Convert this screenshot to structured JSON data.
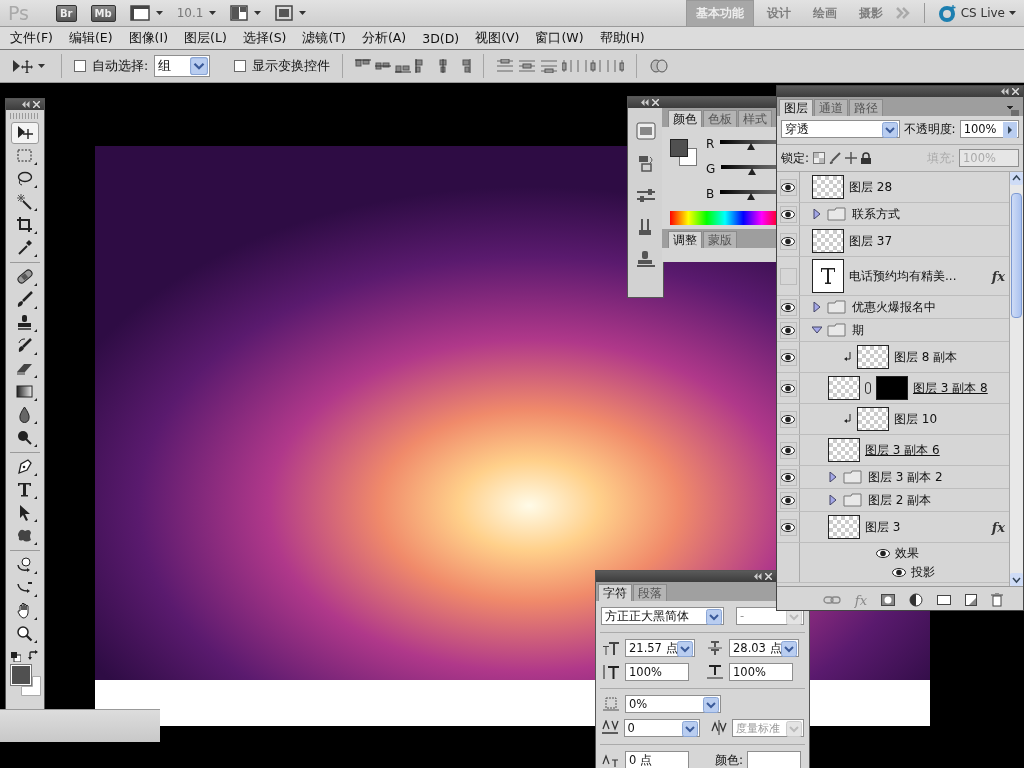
{
  "app_bar": {
    "logo": "Ps",
    "bridge_badge": "Br",
    "mini_bridge_badge": "Mb",
    "zoom": "10.1",
    "workspaces": [
      {
        "label": "基本功能",
        "selected": true
      },
      {
        "label": "设计",
        "selected": false
      },
      {
        "label": "绘画",
        "selected": false
      },
      {
        "label": "摄影",
        "selected": false
      }
    ],
    "cs_live": "CS Live"
  },
  "menu": [
    "文件(F)",
    "编辑(E)",
    "图像(I)",
    "图层(L)",
    "选择(S)",
    "滤镜(T)",
    "分析(A)",
    "3D(D)",
    "视图(V)",
    "窗口(W)",
    "帮助(H)"
  ],
  "options_bar": {
    "auto_select": {
      "label": "自动选择:",
      "checked": false
    },
    "auto_select_target": "组",
    "show_transform_controls": {
      "label": "显示变换控件",
      "checked": false
    }
  },
  "tools": [
    {
      "selected": true
    },
    {
      "selected": false
    },
    {
      "selected": false
    },
    {
      "selected": false
    },
    {
      "selected": false
    },
    {
      "selected": false
    },
    {
      "selected": false
    },
    {
      "selected": false
    },
    {
      "selected": false
    },
    {
      "selected": false
    },
    {
      "selected": false
    },
    {
      "selected": false
    },
    {
      "selected": false
    },
    {
      "selected": false
    },
    {
      "selected": false
    },
    {
      "selected": false
    },
    {
      "selected": false
    },
    {
      "selected": false
    },
    {
      "selected": false
    },
    {
      "selected": false
    },
    {
      "selected": false
    },
    {
      "selected": false
    }
  ],
  "color_panel": {
    "tabs": [
      {
        "label": "颜色",
        "selected": true
      },
      {
        "label": "色板",
        "selected": false
      },
      {
        "label": "样式",
        "selected": false
      }
    ],
    "channels": [
      {
        "name": "R",
        "level": 0.31
      },
      {
        "name": "G",
        "level": 0.31
      },
      {
        "name": "B",
        "level": 0.31
      }
    ],
    "lower_tabs": [
      {
        "label": "调整",
        "selected": true
      },
      {
        "label": "蒙版",
        "selected": false
      }
    ]
  },
  "layers_panel": {
    "tabs": [
      {
        "label": "图层",
        "selected": true
      },
      {
        "label": "通道",
        "selected": false
      },
      {
        "label": "路径",
        "selected": false
      }
    ],
    "blend_mode": "穿透",
    "opacity_label": "不透明度:",
    "opacity": "100%",
    "lock_label": "锁定:",
    "fill_label": "填充:",
    "fill": "100%",
    "fill_disabled": true,
    "footer_style_button": "fx",
    "layers": [
      {
        "name": "图层 28",
        "kind": "layer",
        "visible": true
      },
      {
        "name": "联系方式",
        "kind": "group",
        "visible": true,
        "expanded": false
      },
      {
        "name": "图层 37",
        "kind": "layer",
        "visible": true
      },
      {
        "name": "电话预约均有精美...",
        "kind": "text",
        "visible": false,
        "style_badge": "fx"
      },
      {
        "name": "优惠火爆报名中",
        "kind": "group",
        "visible": true,
        "expanded": false
      },
      {
        "name": "期",
        "kind": "group",
        "visible": true,
        "expanded": true,
        "children": [
          {
            "name": "图层 8 副本",
            "kind": "layer",
            "visible": true,
            "clipped": true
          },
          {
            "name": "图层 3 副本 8",
            "kind": "layer",
            "visible": true,
            "linked": true,
            "mask": true
          },
          {
            "name": "图层 10",
            "kind": "layer",
            "visible": true,
            "clipped": true
          },
          {
            "name": "图层 3 副本 6",
            "kind": "layer",
            "visible": true,
            "linked": true
          },
          {
            "name": "图层 3 副本 2",
            "kind": "group",
            "visible": true,
            "expanded": false
          },
          {
            "name": "图层 2 副本",
            "kind": "group",
            "visible": true,
            "expanded": false
          },
          {
            "name": "图层 3",
            "kind": "layer",
            "visible": true,
            "style_badge": "fx",
            "expanded": true,
            "effects": {
              "label": "效果",
              "items": [
                "投影"
              ]
            }
          }
        ]
      }
    ]
  },
  "character_panel": {
    "tabs": [
      {
        "label": "字符",
        "selected": true
      },
      {
        "label": "段落",
        "selected": false
      }
    ],
    "font_family": "方正正大黑简体",
    "font_style": "-",
    "size": "21.57 点",
    "leading": "28.03 点",
    "vertical_scale": "100%",
    "horizontal_scale": "100%",
    "tsume": "0%",
    "kerning": "0",
    "tracking": "度量标准",
    "tracking_disabled": true,
    "baseline_shift": "0 点",
    "color_label": "颜色:"
  }
}
